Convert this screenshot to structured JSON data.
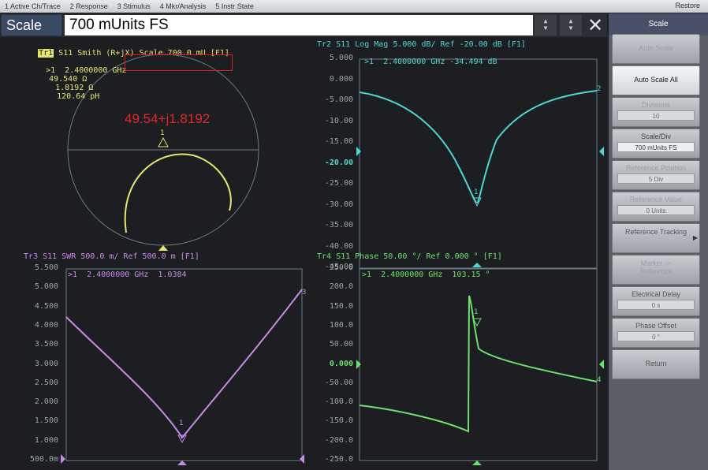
{
  "menubar": {
    "items": [
      "1 Active Ch/Trace",
      "2 Response",
      "3 Stimulus",
      "4 Mkr/Analysis",
      "5 Instr State"
    ],
    "restore": "Restore"
  },
  "entry": {
    "label": "Scale",
    "value": "700 mUnits FS",
    "close_icon": "close-icon"
  },
  "softkeys": {
    "title": "Scale",
    "buttons": [
      {
        "label": "Auto Scale",
        "value": ""
      },
      {
        "label": "Auto Scale All",
        "value": ""
      },
      {
        "label": "Divisions",
        "value": "10"
      },
      {
        "label": "Scale/Div",
        "value": "700 mUnits FS"
      },
      {
        "label": "Reference Position",
        "value": "5 Div"
      },
      {
        "label": "Reference Value",
        "value": "0 Units"
      },
      {
        "label": "Reference Tracking",
        "value": ""
      },
      {
        "label": "Marker -> Reference",
        "value": ""
      },
      {
        "label": "Electrical Delay",
        "value": "0 s"
      },
      {
        "label": "Phase Offset",
        "value": "0 °"
      },
      {
        "label": "Return",
        "value": ""
      }
    ]
  },
  "tr1": {
    "tag": "Tr1",
    "title": " S11 Smith (R+jX) Scale 700.0 mU [F1]",
    "marker_prefix": ">1  2.4000000 GHz ",
    "marker_r": "49.540 Ω",
    "marker_x": "1.8192 Ω",
    "marker_l": "120.64 pH",
    "annotation": "49.54+j1.8192",
    "marker_flag": "1"
  },
  "tr2": {
    "title": "Tr2 S11 Log Mag 5.000 dB/ Ref -20.00 dB [F1]",
    "marker": ">1  2.4000000 GHz -34.494 dB",
    "ticks": [
      "5.000",
      "0.000",
      "-5.000",
      "-10.00",
      "-15.00",
      "-20.00",
      "-25.00",
      "-30.00",
      "-35.00",
      "-40.00",
      "-45.00"
    ],
    "marker_flag": "1",
    "end_label": "2"
  },
  "tr3": {
    "title": "Tr3 S11 SWR 500.0 m/ Ref 500.0 m [F1]",
    "marker": ">1  2.4000000 GHz  1.0384",
    "ticks": [
      "5.500",
      "5.000",
      "4.500",
      "4.000",
      "3.500",
      "3.000",
      "2.500",
      "2.000",
      "1.500",
      "1.000",
      "500.0m"
    ],
    "marker_flag": "1",
    "end_label": "3"
  },
  "tr4": {
    "title": "Tr4 S11 Phase 50.00 °/ Ref 0.000 ° [F1]",
    "marker": ">1  2.4000000 GHz  103.15 °",
    "ticks": [
      "250.0",
      "200.0",
      "150.0",
      "100.0",
      "50.00",
      "0.000",
      "-50.00",
      "-100.0",
      "-150.0",
      "-200.0",
      "-250.0"
    ],
    "marker_flag": "1",
    "end_label": "4"
  },
  "colors": {
    "tr1": "#e6e66e",
    "tr2": "#4fd6d0",
    "tr3": "#c98ae6",
    "tr4": "#6ee06e",
    "grid": "#6b7a86"
  }
}
